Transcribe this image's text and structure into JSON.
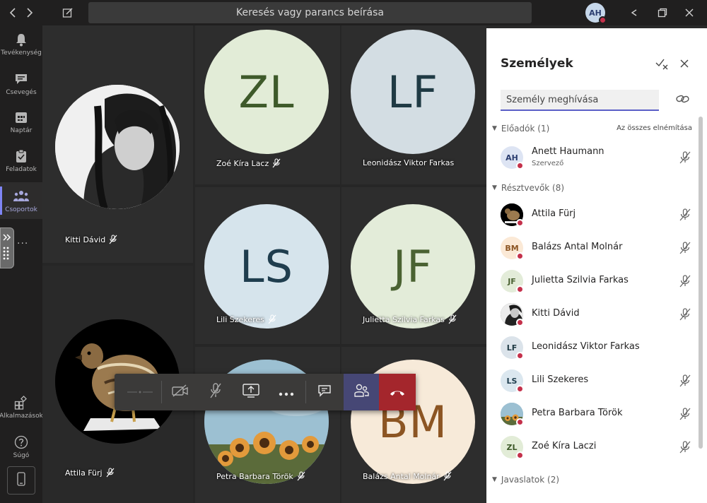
{
  "titlebar": {
    "search_placeholder": "Keresés vagy parancs beírása",
    "avatar_initials": "AH"
  },
  "rail": {
    "items": [
      {
        "label": "Tevékenység",
        "icon": "bell-icon"
      },
      {
        "label": "Csevegés",
        "icon": "chat-icon"
      },
      {
        "label": "Naptár",
        "icon": "calendar-icon"
      },
      {
        "label": "Feladatok",
        "icon": "tasks-icon"
      },
      {
        "label": "Csoportok",
        "icon": "teams-icon"
      }
    ],
    "more": "...",
    "apps_label": "Alkalmazások",
    "help_label": "Súgó"
  },
  "tiles": [
    {
      "name": "Kitti Dávid",
      "type": "photo"
    },
    {
      "name": "Zoé Kíra Lacz",
      "initials": "ZL",
      "bg": "#e2ecd7",
      "fg": "#3e5a2a"
    },
    {
      "name": "Leonidász Viktor Farkas",
      "initials": "LF",
      "bg": "#d3dde3",
      "fg": "#1f3a44"
    },
    {
      "name": "Lili Szekeres",
      "initials": "LS",
      "bg": "#d6e4ec",
      "fg": "#1f3d4e"
    },
    {
      "name": "Julietta Szilvia Farkas",
      "initials": "JF",
      "bg": "#e3ecd9",
      "fg": "#4a6232"
    },
    {
      "name": "Attila Fürj",
      "type": "photo"
    },
    {
      "name": "Petra Barbara Török",
      "type": "photo"
    },
    {
      "name": "Balázs Antal Molnár",
      "initials": "BM",
      "bg": "#f7ead9",
      "fg": "#8c5523"
    }
  ],
  "panel": {
    "title": "Személyek",
    "invite_placeholder": "Személy meghívása",
    "presenters_label": "Előadók (1)",
    "mute_all": "Az összes elnémítása",
    "attendees_label": "Résztvevők (8)",
    "suggestions_label": "Javaslatok (2)",
    "presenters": [
      {
        "name": "Anett Haumann",
        "role": "Szervező",
        "initials": "AH",
        "bg": "#dde4f3",
        "fg": "#2c3e70"
      }
    ],
    "attendees": [
      {
        "name": "Attila Fürj",
        "initials": "",
        "bg": "#111111",
        "fg": "#ffffff",
        "photo": "quail"
      },
      {
        "name": "Balázs Antal Molnár",
        "initials": "BM",
        "bg": "#fbe9d6",
        "fg": "#8c5523"
      },
      {
        "name": "Julietta Szilvia Farkas",
        "initials": "JF",
        "bg": "#e3ecd9",
        "fg": "#4a6232"
      },
      {
        "name": "Kitti Dávid",
        "initials": "",
        "bg": "#555555",
        "fg": "#ffffff",
        "photo": "portrait"
      },
      {
        "name": "Leonidász Viktor Farkas",
        "initials": "LF",
        "bg": "#dbe3ea",
        "fg": "#1f3a44"
      },
      {
        "name": "Lili Szekeres",
        "initials": "LS",
        "bg": "#dbe7ef",
        "fg": "#1f3d4e"
      },
      {
        "name": "Petra Barbara Török",
        "initials": "",
        "bg": "#8fb5c9",
        "fg": "#ffffff",
        "photo": "flowers"
      },
      {
        "name": "Zoé Kíra Laczi",
        "initials": "ZL",
        "bg": "#e2ecd7",
        "fg": "#3e5a2a"
      }
    ]
  },
  "colors": {
    "accent": "#5b5fc7",
    "hangup": "#a4262c",
    "status_busy": "#c4314b"
  }
}
